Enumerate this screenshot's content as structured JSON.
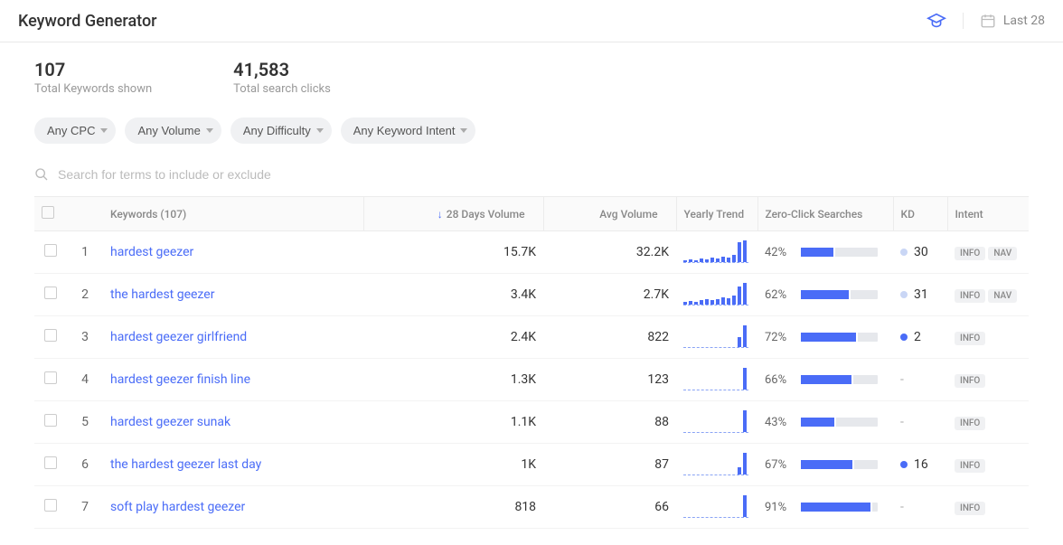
{
  "header": {
    "title": "Keyword Generator",
    "date_label": "Last 28"
  },
  "stats": {
    "total_keywords_value": "107",
    "total_keywords_label": "Total Keywords shown",
    "total_clicks_value": "41,583",
    "total_clicks_label": "Total search clicks"
  },
  "filters": {
    "cpc": "Any CPC",
    "volume": "Any Volume",
    "difficulty": "Any Difficulty",
    "intent": "Any Keyword Intent"
  },
  "search": {
    "placeholder": "Search for terms to include or exclude"
  },
  "table": {
    "headers": {
      "keywords": "Keywords (107)",
      "vol28": "28 Days Volume",
      "avgvol": "Avg Volume",
      "trend": "Yearly Trend",
      "zero": "Zero-Click Searches",
      "kd": "KD",
      "intent": "Intent"
    },
    "rows": [
      {
        "n": "1",
        "kw": "hardest geezer",
        "vol28": "15.7K",
        "avg": "32.2K",
        "trend": [
          2,
          3,
          2,
          4,
          3,
          5,
          4,
          6,
          5,
          8,
          22,
          24
        ],
        "zero": 42,
        "kd": "30",
        "kd_style": "light",
        "intents": [
          "INFO",
          "NAV"
        ]
      },
      {
        "n": "2",
        "kw": "the hardest geezer",
        "vol28": "3.4K",
        "avg": "2.7K",
        "trend": [
          3,
          4,
          3,
          5,
          6,
          5,
          6,
          8,
          7,
          10,
          20,
          24
        ],
        "zero": 62,
        "kd": "31",
        "kd_style": "light",
        "intents": [
          "INFO",
          "NAV"
        ]
      },
      {
        "n": "3",
        "kw": "hardest geezer girlfriend",
        "vol28": "2.4K",
        "avg": "822",
        "trend": [
          0,
          0,
          0,
          0,
          0,
          0,
          0,
          0,
          0,
          0,
          11,
          24
        ],
        "zero": 72,
        "kd": "2",
        "kd_style": "dark",
        "intents": [
          "INFO"
        ]
      },
      {
        "n": "4",
        "kw": "hardest geezer finish line",
        "vol28": "1.3K",
        "avg": "123",
        "trend": [
          0,
          0,
          0,
          0,
          0,
          0,
          0,
          0,
          0,
          0,
          0,
          24
        ],
        "zero": 66,
        "kd": "-",
        "kd_style": "none",
        "intents": [
          "INFO"
        ]
      },
      {
        "n": "5",
        "kw": "hardest geezer sunak",
        "vol28": "1.1K",
        "avg": "88",
        "trend": [
          0,
          0,
          0,
          0,
          0,
          0,
          0,
          0,
          0,
          0,
          0,
          24
        ],
        "zero": 43,
        "kd": "-",
        "kd_style": "none",
        "intents": [
          "INFO"
        ]
      },
      {
        "n": "6",
        "kw": "the hardest geezer last day",
        "vol28": "1K",
        "avg": "87",
        "trend": [
          0,
          0,
          0,
          0,
          0,
          0,
          0,
          0,
          0,
          0,
          8,
          24
        ],
        "zero": 67,
        "kd": "16",
        "kd_style": "dark",
        "intents": [
          "INFO"
        ]
      },
      {
        "n": "7",
        "kw": "soft play hardest geezer",
        "vol28": "818",
        "avg": "66",
        "trend": [
          0,
          0,
          0,
          0,
          0,
          0,
          0,
          0,
          0,
          0,
          0,
          24
        ],
        "zero": 91,
        "kd": "-",
        "kd_style": "none",
        "intents": [
          "INFO"
        ]
      }
    ]
  }
}
